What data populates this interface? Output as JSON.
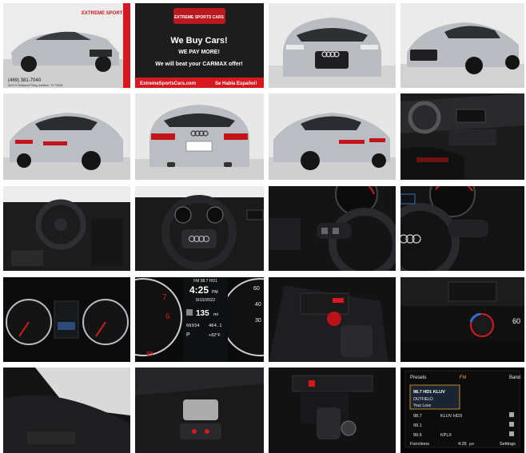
{
  "dealer": {
    "brand_logo_text": "EXTREME SPORTS CARS",
    "phone": "(469) 381-7040",
    "address": "5020 E Beltwood Pkwy, Addison, TX 75001"
  },
  "promo": {
    "headline": "We Buy Cars!",
    "line2": "WE PAY MORE!",
    "line3": "We will beat your CARMAX offer!",
    "website": "ExtremeSportsCars.com",
    "spanish": "Se Habla Español!"
  },
  "cluster": {
    "station": "FM 98.7 HD1",
    "time": "4:25",
    "time_suffix": "PM",
    "date": "9/10/2022",
    "range": "135",
    "range_unit": "mi",
    "odometer": "66934",
    "trip": "464.1",
    "gear": "P",
    "temp": "+82°F",
    "badge": "S5"
  },
  "climate": {
    "temp_display": "60"
  },
  "radio": {
    "header_left": "Presets",
    "header_mid": "FM",
    "header_right": "Band",
    "station_main": "98.7 HD1 KLUV",
    "artist": "OUTFIELD",
    "song": "Your Love",
    "list": [
      {
        "freq": "98.7",
        "name": "KLUV HD3"
      },
      {
        "freq": "99.1",
        "name": ""
      },
      {
        "freq": "99.5",
        "name": "KPLX"
      }
    ],
    "footer_left": "Functions",
    "footer_time": "4:26",
    "footer_time_suffix": "pm",
    "footer_right": "Settings"
  },
  "colors": {
    "accent_red": "#d7191f",
    "car_silver": "#b9bcc1",
    "studio_bg": "#e9e9ea"
  }
}
